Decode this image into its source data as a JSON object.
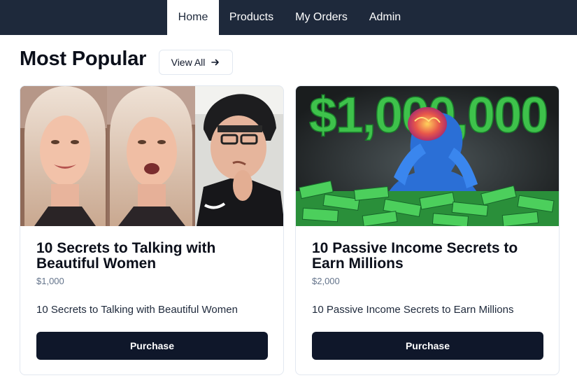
{
  "nav": {
    "items": [
      {
        "label": "Home",
        "active": true
      },
      {
        "label": "Products",
        "active": false
      },
      {
        "label": "My Orders",
        "active": false
      },
      {
        "label": "Admin",
        "active": false
      }
    ]
  },
  "main": {
    "section_title": "Most Popular",
    "view_all_label": "View All",
    "view_all_icon": "arrow-right-icon",
    "products": [
      {
        "title": "10 Secrets to Talking with Beautiful Women",
        "price": "$1,000",
        "description": "10 Secrets to Talking with Beautiful Women",
        "button_label": "Purchase"
      },
      {
        "title": "10 Passive Income Secrets to Earn Millions",
        "price": "$2,000",
        "description": "10 Passive Income Secrets to Earn Millions",
        "button_label": "Purchase",
        "image_text": "$1,000,000"
      }
    ]
  },
  "colors": {
    "navbar_bg": "#1e293b",
    "button_bg": "#0f172a",
    "price_text": "#64748b",
    "money_green": "#3ec24b"
  }
}
